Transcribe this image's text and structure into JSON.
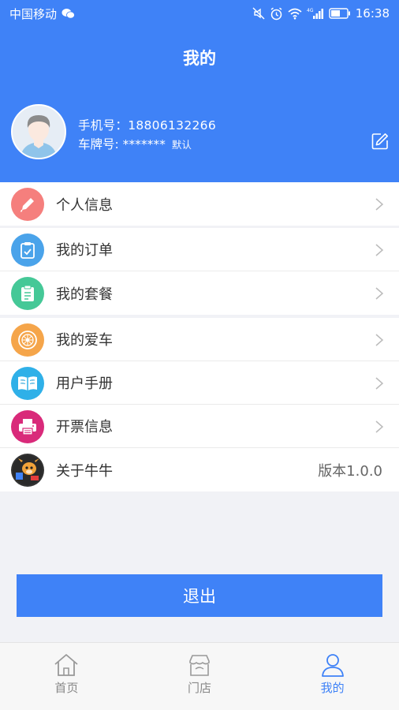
{
  "status_bar": {
    "carrier": "中国移动",
    "time": "16:38",
    "network": "4G"
  },
  "header": {
    "title": "我的",
    "phone_label": "手机号：18806132266",
    "plate_label": "车牌号: *******",
    "plate_default": "默认"
  },
  "menu_group1": [
    {
      "label": "个人信息",
      "icon": "pen-icon",
      "color": "#f57f7d"
    }
  ],
  "menu_group2": [
    {
      "label": "我的订单",
      "icon": "order-clipboard-icon",
      "color": "#4aa3ea"
    },
    {
      "label": "我的套餐",
      "icon": "package-clipboard-icon",
      "color": "#45c897"
    }
  ],
  "menu_group3": [
    {
      "label": "我的爱车",
      "icon": "wheel-icon",
      "color": "#f5a54a"
    },
    {
      "label": "用户手册",
      "icon": "book-icon",
      "color": "#2fb0e8"
    },
    {
      "label": "开票信息",
      "icon": "printer-icon",
      "color": "#d92a7a"
    },
    {
      "label": "关于牛牛",
      "icon": "app-logo-icon",
      "value": "版本1.0.0"
    }
  ],
  "logout_label": "退出",
  "tabs": [
    {
      "label": "首页",
      "icon": "home-icon",
      "active": false
    },
    {
      "label": "门店",
      "icon": "store-icon",
      "active": false
    },
    {
      "label": "我的",
      "icon": "profile-icon",
      "active": true
    }
  ],
  "colors": {
    "primary": "#3f82f7",
    "background": "#f1f2f6"
  }
}
